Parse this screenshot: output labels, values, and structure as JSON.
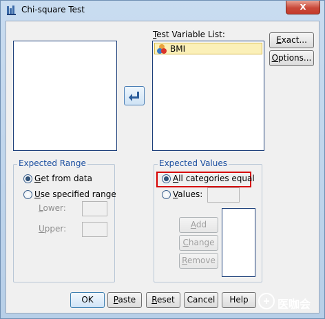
{
  "window": {
    "title": "Chi-square Test",
    "close_label": "x"
  },
  "source_list": {
    "items": []
  },
  "test_variable_list": {
    "label_pre": "",
    "label_u": "T",
    "label_post": "est Variable List:",
    "items": [
      {
        "name": "BMI",
        "icon": "scale-variable-icon"
      }
    ]
  },
  "side_buttons": {
    "exact": {
      "pre": "",
      "u": "E",
      "post": "xact..."
    },
    "options": {
      "pre": "",
      "u": "O",
      "post": "ptions..."
    }
  },
  "expected_range": {
    "legend": "Expected Range",
    "get_from_data": {
      "pre": "",
      "u": "G",
      "post": "et from data",
      "selected": true
    },
    "use_specified": {
      "pre": "",
      "u": "U",
      "post": "se specified range",
      "selected": false
    },
    "lower": {
      "pre": "",
      "u": "L",
      "post": "ower:",
      "value": ""
    },
    "upper": {
      "pre": "",
      "u": "U",
      "post": "pper:",
      "value": ""
    }
  },
  "expected_values": {
    "legend": "Expected Values",
    "all_equal": {
      "pre": "",
      "u": "A",
      "post": "ll categories equal",
      "selected": true
    },
    "values": {
      "pre": "",
      "u": "V",
      "post": "alues:",
      "selected": false,
      "value": ""
    },
    "add": {
      "pre": "",
      "u": "A",
      "post": "dd"
    },
    "change": {
      "pre": "",
      "u": "C",
      "post": "hange"
    },
    "remove": {
      "pre": "",
      "u": "R",
      "post": "emove"
    },
    "values_list": []
  },
  "footer": {
    "ok": "OK",
    "paste": {
      "pre": "",
      "u": "P",
      "post": "aste"
    },
    "reset": {
      "pre": "",
      "u": "R",
      "post": "eset"
    },
    "cancel": "Cancel",
    "help": "Help"
  },
  "watermark": {
    "text": "医咖会"
  },
  "colors": {
    "highlight": "#d60000",
    "accent": "#3c7fb1"
  }
}
